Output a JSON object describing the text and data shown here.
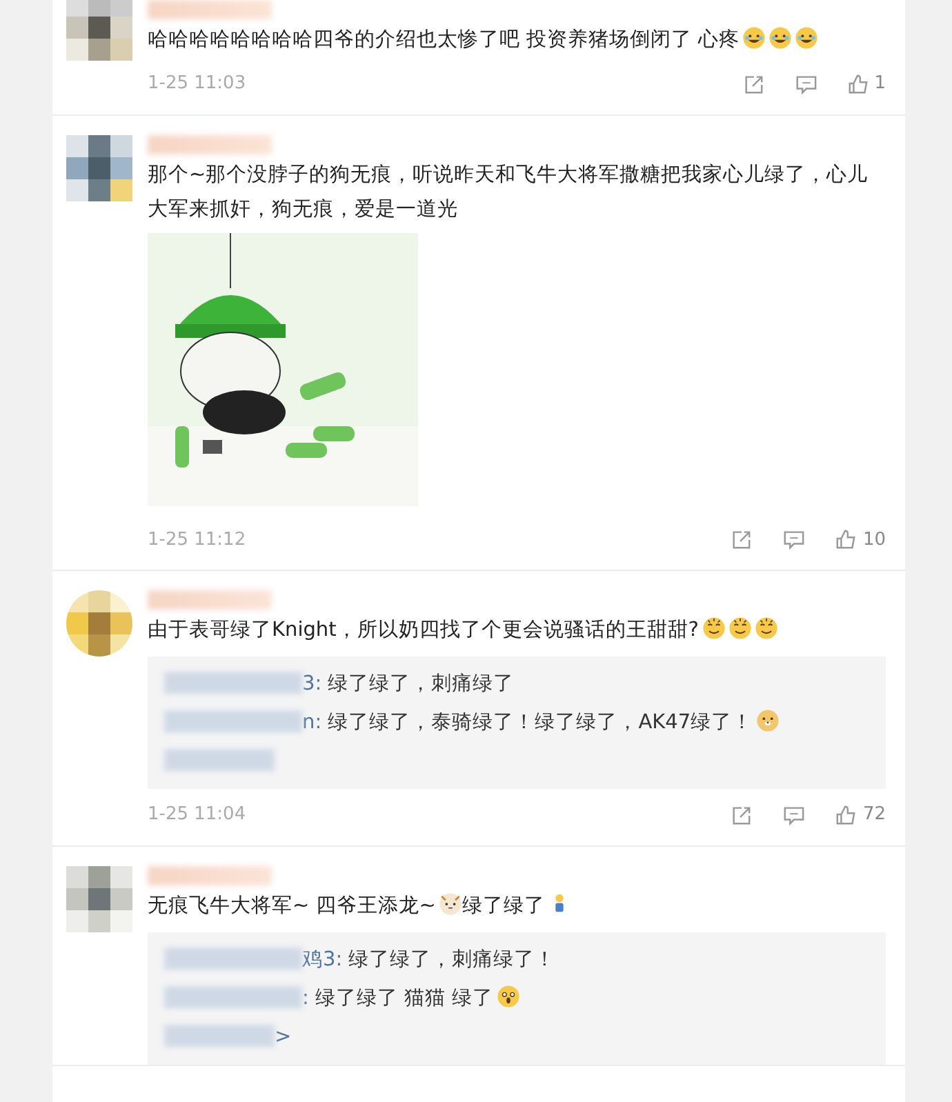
{
  "comments": [
    {
      "avatar_top_cut": true,
      "body": [
        {
          "kind": "text",
          "text": "哈哈哈哈哈哈哈哈四爷的介绍也太惨了吧 投资养猪场倒闭了 心疼"
        },
        {
          "kind": "laugh"
        },
        {
          "kind": "laugh"
        },
        {
          "kind": "laugh"
        }
      ],
      "time": "1-25 11:03",
      "likes": "1"
    },
    {
      "body": [
        {
          "kind": "text",
          "text": "那个~那个没脖子的狗无痕，听说昨天和飞牛大将军撒糖把我家心儿绿了，心儿大军来抓奸，狗无痕，爱是一道光"
        }
      ],
      "image": {
        "kind": "picture"
      },
      "time": "1-25 11:12",
      "likes": "10"
    },
    {
      "body": [
        {
          "kind": "text",
          "text": "由于表哥绿了Knight，所以奶四找了个更会说骚话的王甜甜?"
        },
        {
          "kind": "smug"
        },
        {
          "kind": "smug"
        },
        {
          "kind": "smug"
        }
      ],
      "replies": [
        {
          "author_tail": "3:",
          "body": [
            {
              "kind": "text",
              "text": "绿了绿了，刺痛绿了"
            }
          ]
        },
        {
          "author_tail": "n:",
          "body": [
            {
              "kind": "text",
              "text": "绿了绿了，泰骑绿了！绿了绿了，AK47绿了！"
            },
            {
              "kind": "dog"
            }
          ]
        }
      ],
      "time": "1-25 11:04",
      "likes": "72"
    },
    {
      "body": [
        {
          "kind": "text",
          "text": "无痕飞牛大将军~  四爷王添龙~"
        },
        {
          "kind": "cat"
        },
        {
          "kind": "text",
          "text": "绿了绿了"
        },
        {
          "kind": "figure"
        }
      ],
      "replies": [
        {
          "author_tail": "鸡3:",
          "body": [
            {
              "kind": "text",
              "text": "绿了绿了，刺痛绿了！"
            }
          ]
        },
        {
          "author_tail": ":",
          "body": [
            {
              "kind": "text",
              "text": "绿了绿了 猫猫 绿了"
            },
            {
              "kind": "shock"
            }
          ]
        }
      ],
      "more": ">"
    }
  ]
}
